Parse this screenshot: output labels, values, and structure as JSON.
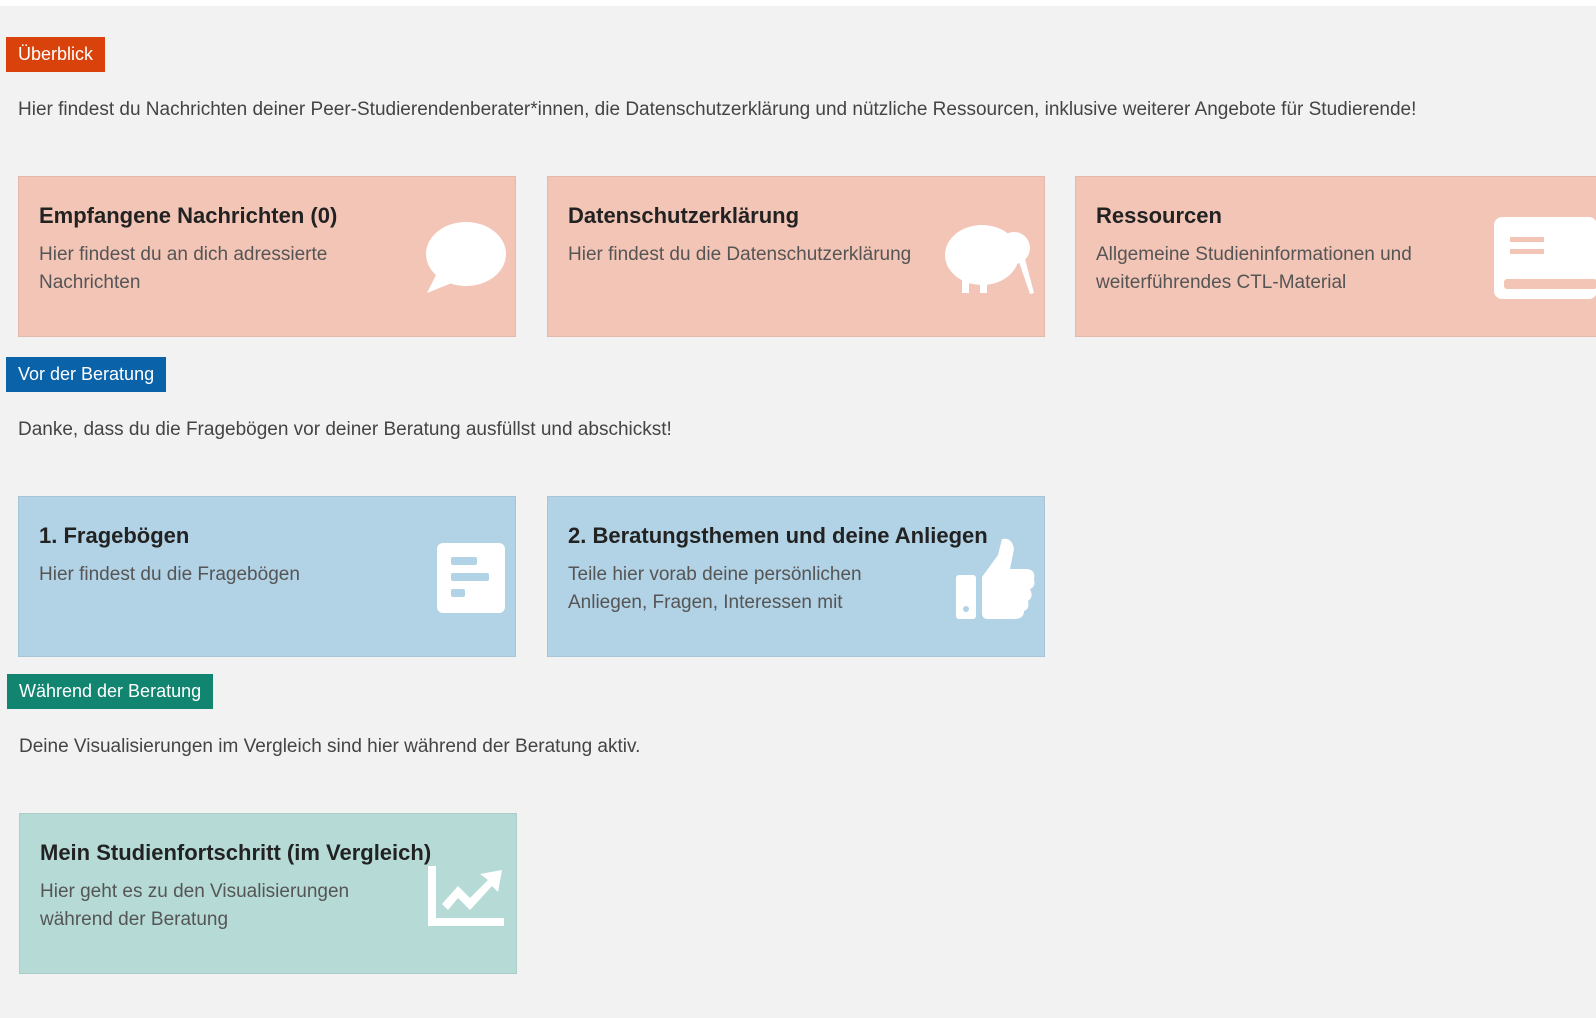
{
  "sections": {
    "overview": {
      "tag": "Überblick",
      "intro": "Hier findest du Nachrichten deiner Peer-Studierendenberater*innen, die Datenschutzerklärung und nützliche Ressourcen, inklusive weiterer Angebote für Studierende!",
      "cards": [
        {
          "title": "Empfangene Nachrichten (0)",
          "text": "Hier findest du an dich adressierte Nachrichten",
          "icon": "speech-bubble-icon"
        },
        {
          "title": "Datenschutzerklärung",
          "text": "Hier findest du die Datenschutzerklärung",
          "icon": "kiwi-bird-icon"
        },
        {
          "title": "Ressourcen",
          "text": "Allgemeine Studieninformationen und weiterführendes CTL-Material",
          "icon": "book-icon"
        }
      ]
    },
    "before": {
      "tag": "Vor der Beratung",
      "intro": "Danke, dass du die Fragebögen vor deiner Beratung ausfüllst und abschickst!",
      "cards": [
        {
          "title": "1. Fragebögen",
          "text": "Hier findest du die Fragebögen",
          "icon": "survey-form-icon"
        },
        {
          "title": "2. Beratungsthemen und deine Anliegen",
          "text": "Teile hier vorab deine persönlichen Anliegen, Fragen, Interessen mit",
          "icon": "thumbs-up-icon"
        }
      ]
    },
    "during": {
      "tag": "Während der Beratung",
      "intro": "Deine Visualisierungen im Vergleich sind hier während der Beratung aktiv.",
      "cards": [
        {
          "title": "Mein Studienfortschritt (im Vergleich)",
          "text": "Hier geht es zu den Visualisierungen während der Beratung",
          "icon": "chart-line-icon"
        }
      ]
    }
  },
  "colors": {
    "overview_tag": "#d9420b",
    "before_tag": "#0a62a8",
    "during_tag": "#128570",
    "overview_card": "#f2c5b6",
    "before_card": "#b2d2e5",
    "during_card": "#b6dbd6"
  }
}
